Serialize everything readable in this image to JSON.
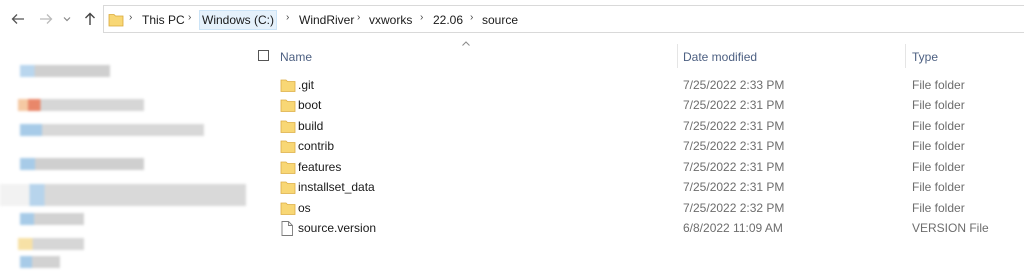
{
  "navigation": {
    "back_icon": "arrow-left-icon",
    "forward_icon": "arrow-right-icon",
    "recent_icon": "chevron-down-icon",
    "up_icon": "arrow-up-icon"
  },
  "address_bar": {
    "folder_icon": "folder-icon",
    "breadcrumbs": [
      "This PC",
      "Windows (C:)",
      "WindRiver",
      "vxworks",
      "22.06",
      "source"
    ],
    "separator_icon": "chevron-right-icon"
  },
  "columns": {
    "name": "Name",
    "date_modified": "Date modified",
    "type": "Type",
    "sorted_by": "Name",
    "sort_direction": "ascending"
  },
  "files": [
    {
      "name": ".git",
      "date": "7/25/2022 2:33 PM",
      "type": "File folder",
      "icon": "folder-icon"
    },
    {
      "name": "boot",
      "date": "7/25/2022 2:31 PM",
      "type": "File folder",
      "icon": "folder-icon"
    },
    {
      "name": "build",
      "date": "7/25/2022 2:31 PM",
      "type": "File folder",
      "icon": "folder-icon"
    },
    {
      "name": "contrib",
      "date": "7/25/2022 2:31 PM",
      "type": "File folder",
      "icon": "folder-icon"
    },
    {
      "name": "features",
      "date": "7/25/2022 2:31 PM",
      "type": "File folder",
      "icon": "folder-icon"
    },
    {
      "name": "installset_data",
      "date": "7/25/2022 2:31 PM",
      "type": "File folder",
      "icon": "folder-icon"
    },
    {
      "name": "os",
      "date": "7/25/2022 2:32 PM",
      "type": "File folder",
      "icon": "folder-icon"
    },
    {
      "name": "source.version",
      "date": "6/8/2022 11:09 AM",
      "type": "VERSION File",
      "icon": "file-icon"
    }
  ],
  "colors": {
    "folder_yellow": "#f8d775",
    "selected_crumb_bg": "#e5f1fb",
    "header_text": "#4d6082",
    "detail_text": "#6d6d6d"
  }
}
